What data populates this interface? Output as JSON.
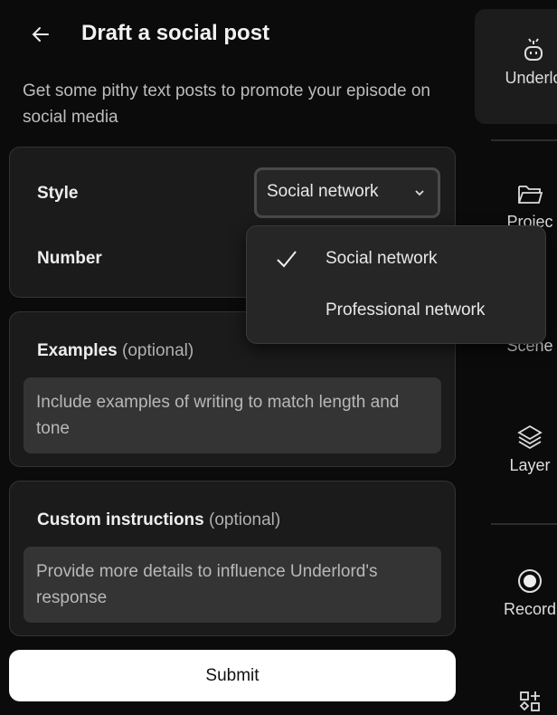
{
  "header": {
    "title": "Draft a social post",
    "description": "Get some pithy text posts to promote your episode on social media"
  },
  "settings": {
    "style_label": "Style",
    "style_value": "Social network",
    "number_label": "Number"
  },
  "dropdown": {
    "options": [
      {
        "label": "Social network",
        "selected": true
      },
      {
        "label": "Professional network",
        "selected": false
      }
    ]
  },
  "examples": {
    "label": "Examples",
    "optional": "(optional)",
    "placeholder": "Include examples of writing to match length and tone"
  },
  "custom": {
    "label": "Custom instructions",
    "optional": "(optional)",
    "placeholder": "Provide more details to influence Underlord's response"
  },
  "submit_label": "Submit",
  "sidebar": {
    "items": [
      {
        "label": "Underlo",
        "icon": "robot-icon",
        "active": true
      },
      {
        "label": "Projec",
        "icon": "folder-icon"
      },
      {
        "label": "Scene",
        "icon": "scenes-icon"
      },
      {
        "label": "Layer",
        "icon": "layers-icon"
      },
      {
        "label": "Record",
        "icon": "record-icon"
      },
      {
        "label": "",
        "icon": "elements-icon"
      }
    ]
  }
}
